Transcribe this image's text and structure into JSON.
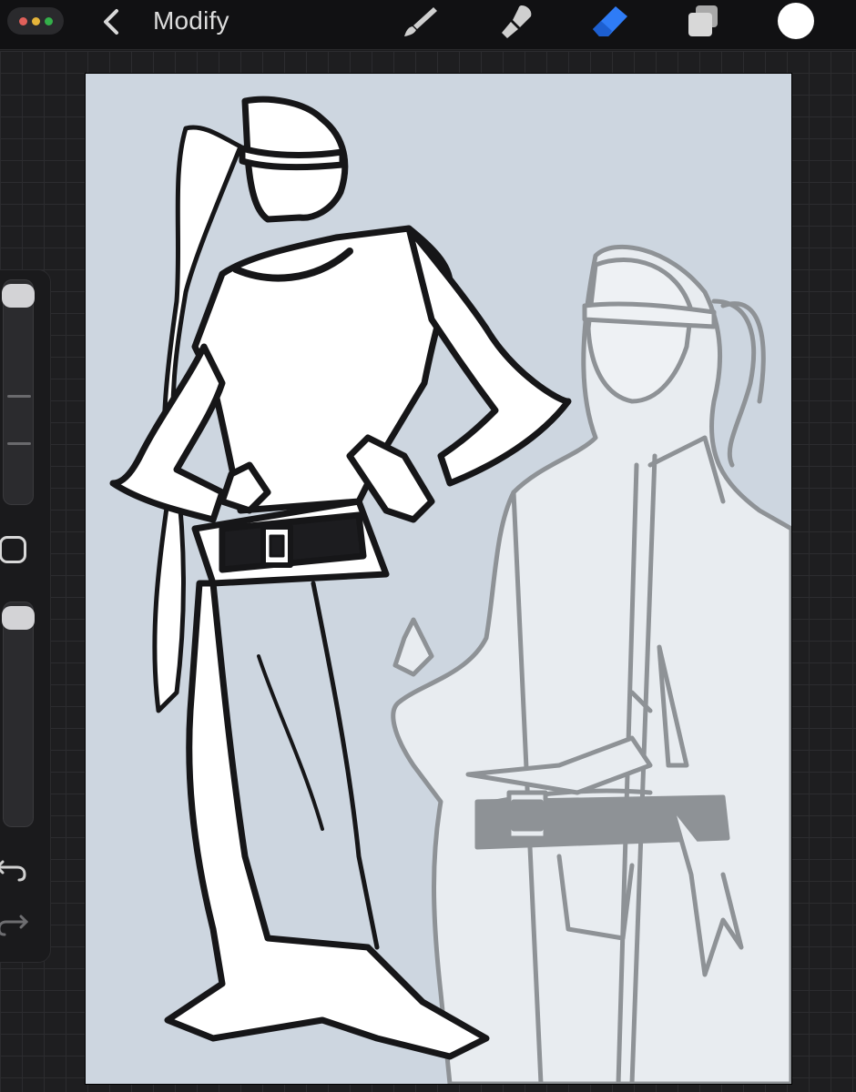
{
  "topbar": {
    "title": "Modify",
    "window_dots_colors": [
      "#ff5f57",
      "#febc2e",
      "#28c840"
    ],
    "tools": [
      {
        "name": "brush-icon",
        "active": false
      },
      {
        "name": "smudge-icon",
        "active": false
      },
      {
        "name": "eraser-icon",
        "active": true
      },
      {
        "name": "layers-icon",
        "active": false
      }
    ],
    "active_color": "#ffffff",
    "accent_color": "#2f80ff"
  },
  "sidebar": {
    "brush_size_level": 0.95,
    "opacity_level": 0.95
  },
  "canvas": {
    "background_color": "#cdd6e0"
  }
}
